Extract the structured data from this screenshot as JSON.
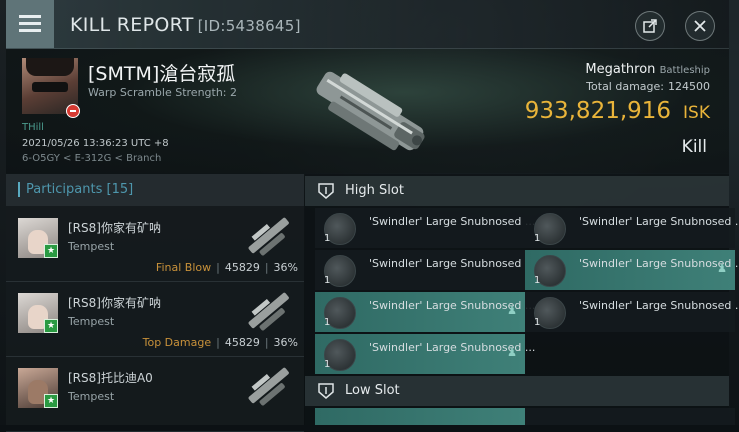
{
  "window": {
    "title": "KILL REPORT",
    "report_id": "[ID:5438645]"
  },
  "icons": {
    "menu": "hamburger-menu-icon",
    "share": "share-icon",
    "close": "close-icon",
    "slot": "shield-slot-icon",
    "pilot": "pilot-icon"
  },
  "victim": {
    "name": "[SMTM]滄台寂孤",
    "warp_scramble": "Warp Scramble Strength: 2",
    "corp": "THill",
    "datetime": "2021/05/26 13:36:23 UTC +8",
    "location": "6-O5GY < E-312G < Branch",
    "ship_name": "Megathron",
    "ship_class": "Battleship",
    "total_damage_label": "Total damage:",
    "total_damage": "124500",
    "isk_value": "933,821,916",
    "isk_unit": "ISK",
    "result": "Kill"
  },
  "participants": {
    "header": "Participants",
    "count": "[15]",
    "items": [
      {
        "name": "[RS8]你家有矿呐",
        "ship": "Tempest",
        "role": "Final Blow",
        "damage": "45829",
        "percent": "36%"
      },
      {
        "name": "[RS8]你家有矿呐",
        "ship": "Tempest",
        "role": "Top Damage",
        "damage": "45829",
        "percent": "36%"
      },
      {
        "name": "[RS8]托比迪A0",
        "ship": "Tempest",
        "role": "",
        "damage": "",
        "percent": ""
      }
    ]
  },
  "slots": {
    "high_slot_label": "High Slot",
    "low_slot_label": "Low Slot",
    "high_modules": [
      {
        "qty": "1",
        "name": "'Swindler' Large Snubnosed ..."
      },
      {
        "qty": "1",
        "name": "'Swindler' Large Snubnosed ..."
      },
      {
        "qty": "1",
        "name": "'Swindler' Large Snubnosed ..."
      },
      {
        "qty": "1",
        "name": "'Swindler' Large Snubnosed ..."
      },
      {
        "qty": "1",
        "name": "'Swindler' Large Snubnosed ..."
      },
      {
        "qty": "1",
        "name": "'Swindler' Large Snubnosed ..."
      },
      {
        "qty": "1",
        "name": "'Swindler' Large Snubnosed ..."
      }
    ]
  }
}
